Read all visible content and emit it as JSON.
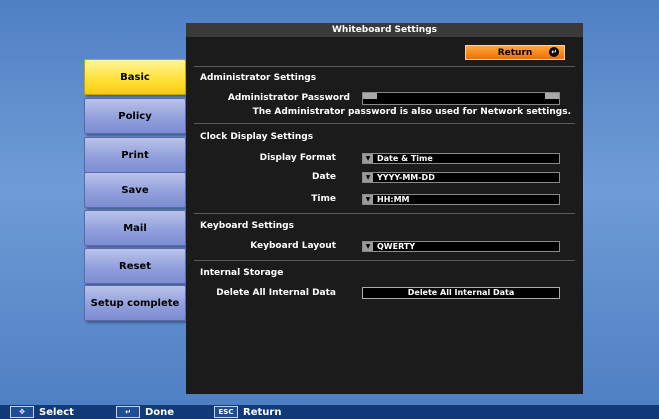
{
  "tabs": [
    {
      "label": "Basic",
      "active": true
    },
    {
      "label": "Policy",
      "active": false
    },
    {
      "label": "Print",
      "active": false
    },
    {
      "label": "Save",
      "active": false
    },
    {
      "label": "Mail",
      "active": false
    },
    {
      "label": "Reset",
      "active": false
    },
    {
      "label": "Setup complete",
      "active": false
    }
  ],
  "panel": {
    "title": "Whiteboard Settings",
    "return_label": "Return",
    "admin": {
      "section": "Administrator Settings",
      "password_label": "Administrator Password",
      "note": "The Administrator password is also used for Network settings."
    },
    "clock": {
      "section": "Clock Display Settings",
      "format_label": "Display Format",
      "format_value": "Date & Time",
      "date_label": "Date",
      "date_value": "YYYY-MM-DD",
      "time_label": "Time",
      "time_value": "HH:MM"
    },
    "keyboard": {
      "section": "Keyboard Settings",
      "layout_label": "Keyboard Layout",
      "layout_value": "QWERTY"
    },
    "storage": {
      "section": "Internal Storage",
      "delete_label": "Delete All Internal Data",
      "delete_button": "Delete All Internal Data"
    }
  },
  "footer": {
    "select": "Select",
    "done": "Done",
    "return": "Return",
    "esc_key": "ESC"
  },
  "colors": {
    "active_tab": "#ffe035",
    "tab": "#8f9ddb",
    "return_button": "#f07000",
    "background": "#6f9cd6"
  }
}
